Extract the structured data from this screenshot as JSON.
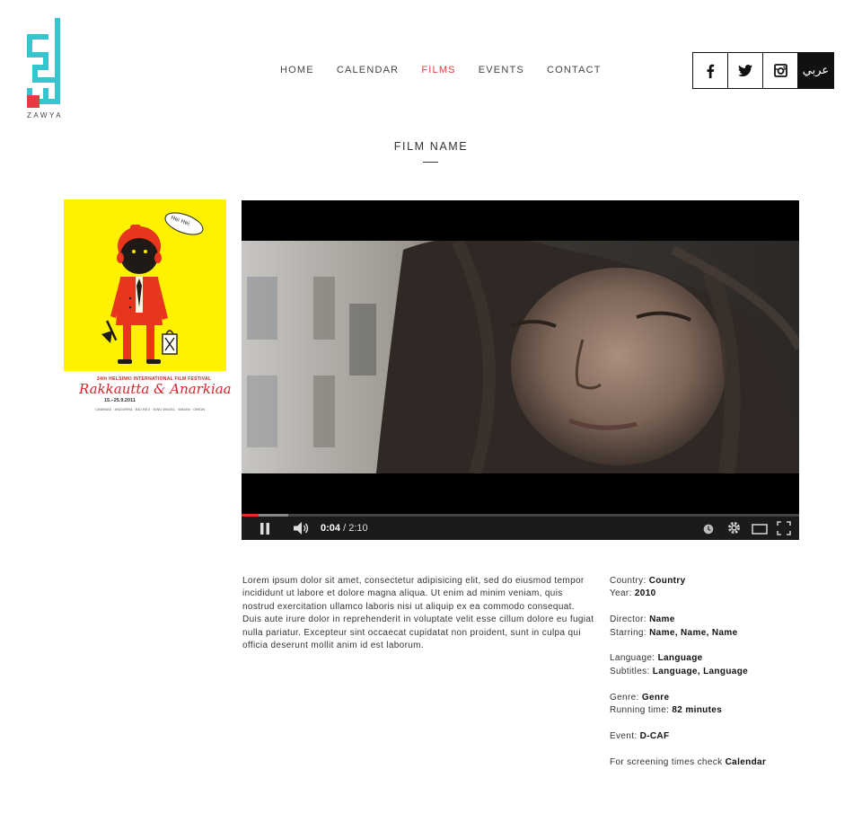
{
  "brand": {
    "name": "ZAWYA"
  },
  "nav": {
    "items": [
      {
        "label": "HOME"
      },
      {
        "label": "CALENDAR"
      },
      {
        "label": "FILMS",
        "active": true
      },
      {
        "label": "EVENTS"
      },
      {
        "label": "CONTACT"
      }
    ],
    "active_color": "#e53b41"
  },
  "social": {
    "icons": [
      "facebook-icon",
      "twitter-icon",
      "instagram-icon"
    ],
    "language_label": "عربي"
  },
  "page": {
    "title": "FILM NAME"
  },
  "poster": {
    "speech": "Hei Hei",
    "festival_line": "24th HELSINKI INTERNATIONAL FILM FESTIVAL",
    "festival_name": "Rakkautta & Anarkiaa",
    "dates": "15.–25.9.2011",
    "footer_line": "CINEMAS · ANDORRA · BIO REX · KINO ENGEL · MAXIM · ORION"
  },
  "video": {
    "current_time": "0:04",
    "duration": "2:10",
    "played_fraction": 0.031,
    "buffered_fraction": 0.083
  },
  "description": "Lorem ipsum dolor sit amet, consectetur adipisicing elit, sed do eiusmod tempor incididunt ut labore et dolore magna aliqua. Ut enim ad minim veniam, quis nostrud exercitation ullamco laboris nisi ut aliquip ex ea commodo consequat. Duis aute irure dolor in reprehenderit in voluptate velit esse cillum dolore eu fugiat nulla pariatur. Excepteur sint occaecat cupidatat non proident, sunt in culpa qui officia deserunt mollit anim id est laborum.",
  "info": {
    "country_label": "Country:",
    "country": "Country",
    "year_label": "Year:",
    "year": "2010",
    "director_label": "Director:",
    "director": "Name",
    "starring_label": "Starring:",
    "starring": "Name, Name, Name",
    "language_label": "Language:",
    "language": "Language",
    "subtitles_label": "Subtitles:",
    "subtitles": "Language, Language",
    "genre_label": "Genre:",
    "genre": "Genre",
    "running_label": "Running time:",
    "running": "82 minutes",
    "event_label": "Event:",
    "event": "D-CAF",
    "screening_label": "For screening times check",
    "screening_link": "Calendar"
  }
}
